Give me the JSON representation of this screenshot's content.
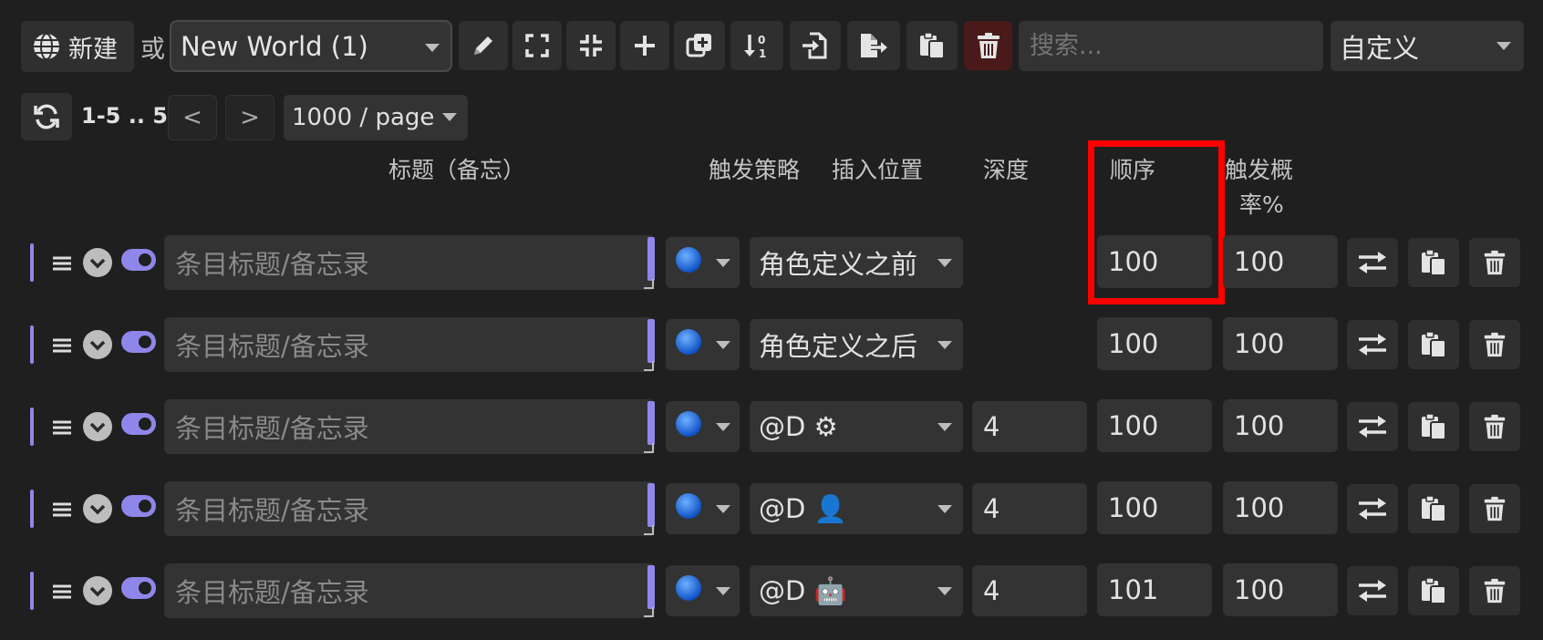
{
  "toolbar": {
    "new_label": "新建",
    "or_label": "或",
    "world_select_value": "New World (1)",
    "search_placeholder": "搜索...",
    "sort_select_value": "自定义"
  },
  "pager": {
    "range": "1-5 .. 5",
    "prev": "<",
    "next": ">",
    "page_size": "1000 / page"
  },
  "columns": {
    "title": "标题（备忘）",
    "strategy": "触发策略",
    "position": "插入位置",
    "depth": "深度",
    "order": "顺序",
    "probability_line1": "触发概",
    "probability_line2": "率%"
  },
  "entries": [
    {
      "title_placeholder": "条目标题/备忘录",
      "position": "角色定义之前",
      "depth": "",
      "order": "100",
      "probability": "100"
    },
    {
      "title_placeholder": "条目标题/备忘录",
      "position": "角色定义之后",
      "depth": "",
      "order": "100",
      "probability": "100"
    },
    {
      "title_placeholder": "条目标题/备忘录",
      "position": "@D ⚙",
      "depth": "4",
      "order": "100",
      "probability": "100"
    },
    {
      "title_placeholder": "条目标题/备忘录",
      "position": "@D 👤",
      "depth": "4",
      "order": "100",
      "probability": "100"
    },
    {
      "title_placeholder": "条目标题/备忘录",
      "position": "@D 🤖",
      "depth": "4",
      "order": "101",
      "probability": "100"
    }
  ],
  "colors": {
    "background": "#1f1f1f",
    "accent": "#8f86ea",
    "highlight": "#ff0000",
    "strategy_dot": "#1e6fe0"
  }
}
